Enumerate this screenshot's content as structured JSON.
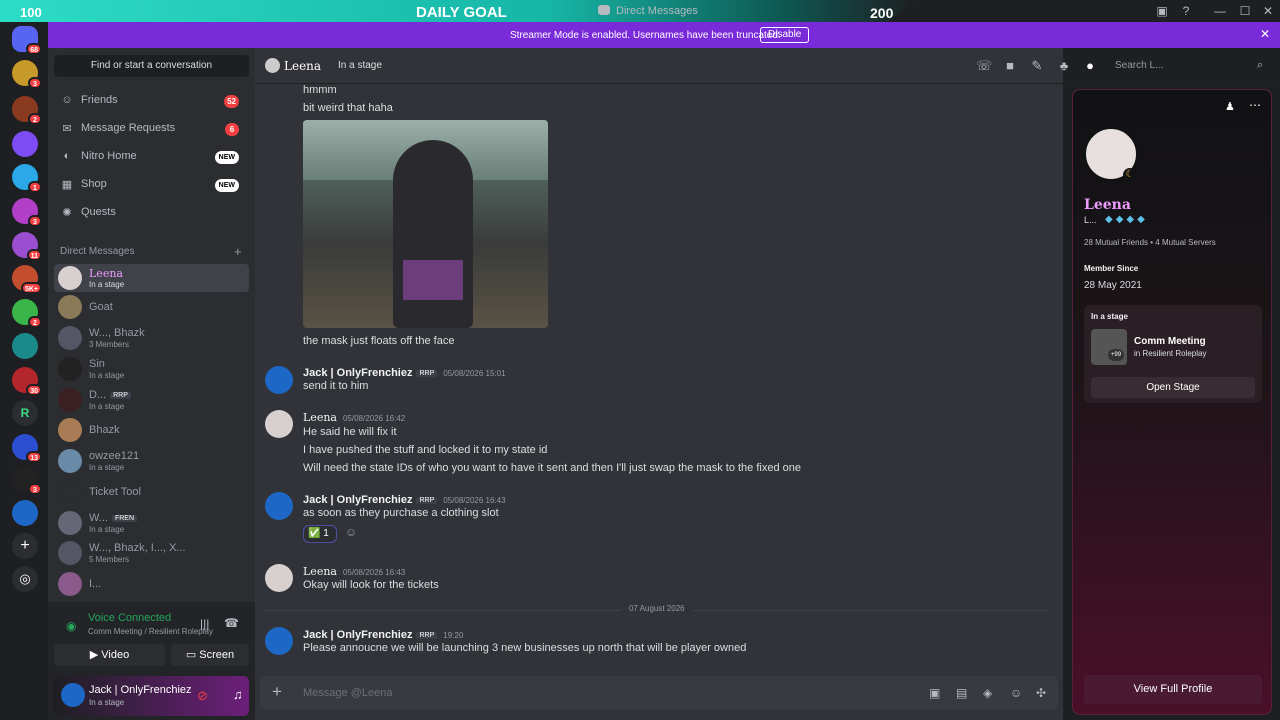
{
  "goal": {
    "left": "100",
    "mid": "DAILY GOAL",
    "right": "200"
  },
  "window": {
    "title": "Direct Messages"
  },
  "banner": {
    "text": "Streamer Mode is enabled. Usernames have been truncated.",
    "button": "Disable"
  },
  "rail": {
    "badges": [
      "68",
      "3",
      "2",
      "",
      "1",
      "3",
      "11",
      "5K+",
      "2",
      "",
      "30",
      "",
      "13",
      "3",
      "",
      ""
    ]
  },
  "sidebar": {
    "search": "Find or start a conversation",
    "nav": [
      {
        "label": "Friends",
        "count": "52"
      },
      {
        "label": "Message Requests",
        "count": "6"
      },
      {
        "label": "Nitro Home",
        "new": "NEW"
      },
      {
        "label": "Shop",
        "new": "NEW"
      },
      {
        "label": "Quests"
      }
    ],
    "dm_header": "Direct Messages",
    "dms": [
      {
        "name": "Leena",
        "sub": "In a stage"
      },
      {
        "name": "Goat",
        "sub": ""
      },
      {
        "name": "W..., Bhazk",
        "sub": "3 Members"
      },
      {
        "name": "Sin",
        "sub": "In a stage"
      },
      {
        "name": "D...",
        "tag": "RRP",
        "sub": "In a stage"
      },
      {
        "name": "Bhazk",
        "sub": ""
      },
      {
        "name": "owzee121",
        "sub": "In a stage"
      },
      {
        "name": "Ticket Tool",
        "sub": ""
      },
      {
        "name": "W...",
        "tag": "FREN",
        "sub": "In a stage"
      },
      {
        "name": "W..., Bhazk, I..., X...",
        "sub": "5 Members"
      },
      {
        "name": "I...",
        "sub": ""
      }
    ]
  },
  "voice": {
    "title": "Voice Connected",
    "sub": "Comm Meeting / Resilient Roleplay",
    "video": "Video",
    "screen": "Screen"
  },
  "user": {
    "name": "Jack | OnlyFrenchiez",
    "status": "In a stage"
  },
  "chat": {
    "name": "Leena",
    "status": "In a stage",
    "search_placeholder": "Search L...",
    "top_lines": [
      "hmmm",
      "bit weird that haha"
    ],
    "image_caption": "the mask just floats off the face",
    "messages": [
      {
        "author": "Jack | OnlyFrenchiez",
        "tag": "RRP",
        "ts": "05/08/2026 15:01",
        "lines": [
          "send it to him"
        ]
      },
      {
        "author": "Leena",
        "ts": "05/08/2026 16:42",
        "lines": [
          "He said he will fix it",
          "I have pushed the stuff and locked it to my state id",
          "Will need the state IDs of who you want to have it sent and then I'll just swap the mask to the fixed one"
        ]
      },
      {
        "author": "Jack | OnlyFrenchiez",
        "tag": "RRP",
        "ts": "05/08/2026 16:43",
        "lines": [
          "as soon as they purchase a clothing slot"
        ]
      },
      {
        "author": "Leena",
        "ts": "05/08/2026 16:43",
        "lines": [
          "Okay will look for the tickets"
        ]
      },
      {
        "author": "Jack | OnlyFrenchiez",
        "tag": "RRP",
        "ts": "19:20",
        "lines": [
          "Please annoucne we will be launching 3 new businesses up north that will be player owned"
        ]
      }
    ],
    "reaction": {
      "emoji": "✅",
      "count": "1"
    },
    "date_divider": "07 August 2026",
    "composer_placeholder": "Message @Leena"
  },
  "profile": {
    "name": "Leena",
    "sub": "L...",
    "mutual": "28 Mutual Friends • 4 Mutual Servers",
    "member_since_label": "Member Since",
    "member_since": "28 May 2021",
    "stage_header": "In a stage",
    "stage_title": "Comm Meeting",
    "stage_sub": "in Resilient Roleplay",
    "stage_more": "+99",
    "open_stage": "Open Stage",
    "full_profile": "View Full Profile"
  },
  "colors": {
    "accent": "#5865f2",
    "banner": "#7a2bd9",
    "online": "#23a55a",
    "danger": "#f23f42"
  }
}
